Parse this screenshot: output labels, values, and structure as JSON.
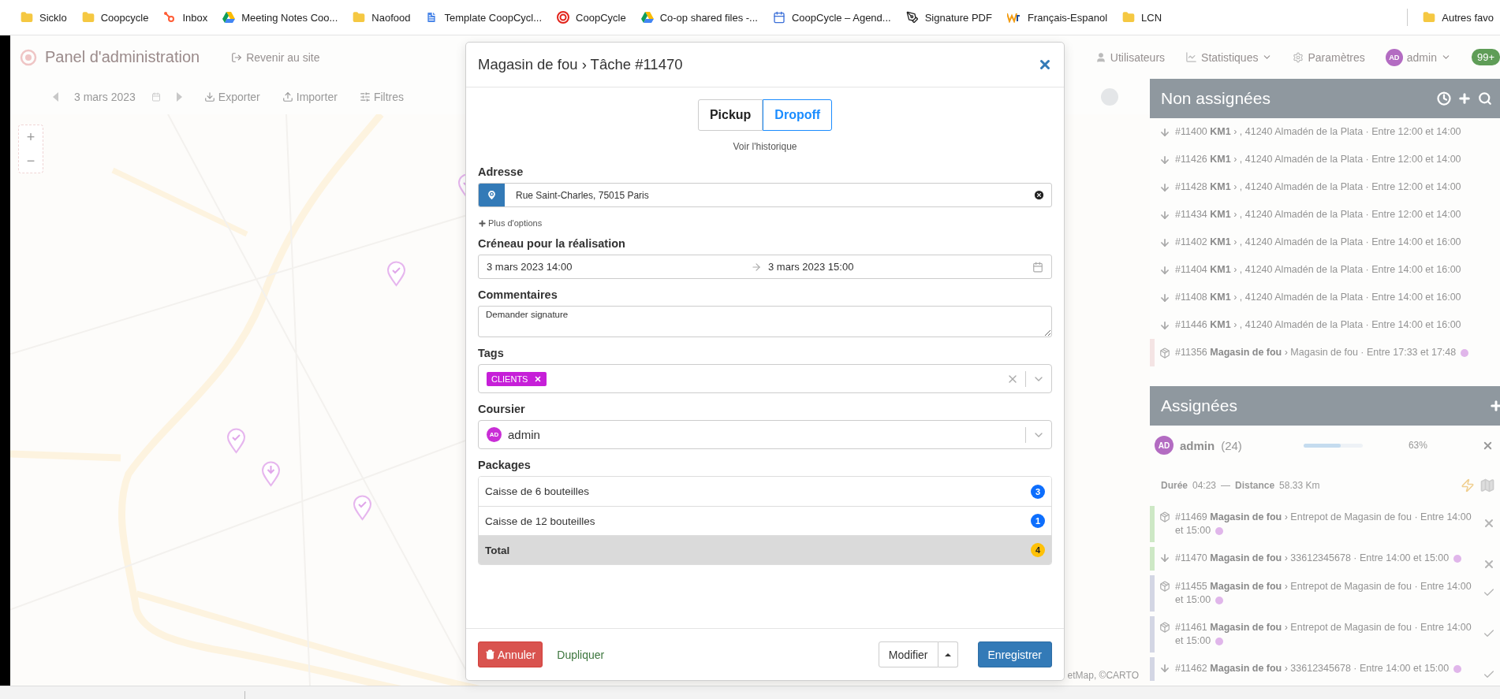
{
  "bookmarks": [
    {
      "label": "Sicklo"
    },
    {
      "label": "Coopcycle"
    },
    {
      "label": "Inbox"
    },
    {
      "label": "Meeting Notes Coo..."
    },
    {
      "label": "Naofood"
    },
    {
      "label": "Template CoopCycl..."
    },
    {
      "label": "CoopCycle"
    },
    {
      "label": "Co-op shared files -..."
    },
    {
      "label": "CoopCycle – Agend..."
    },
    {
      "label": "Signature PDF"
    },
    {
      "label": "Français-Espanol"
    },
    {
      "label": "LCN"
    }
  ],
  "other_bookmarks": "Autres favo",
  "admin_nav": {
    "title": "Panel d'administration",
    "back_link": "Revenir au site",
    "links": [
      {
        "label": "Utilisateurs",
        "dropdown": false
      },
      {
        "label": "Statistiques",
        "dropdown": true
      },
      {
        "label": "Paramètres",
        "dropdown": false
      }
    ],
    "user": {
      "initials": "AD",
      "name": "admin"
    },
    "notifications": "99+"
  },
  "toolbar": {
    "date": "3 mars 2023",
    "actions": [
      "Exporter",
      "Importer",
      "Filtres"
    ]
  },
  "map": {
    "zoom_in": "+",
    "zoom_out": "−",
    "attribution": "etMap, ©CARTO",
    "markers": [
      {
        "kind": "done"
      },
      {
        "kind": "done"
      },
      {
        "kind": "done"
      },
      {
        "kind": "dropoff"
      },
      {
        "kind": "done"
      }
    ]
  },
  "unassigned": {
    "title": "Non assignées",
    "tasks": [
      {
        "kind": "dropoff",
        "text": "#11400 **KM1** › , 41240 Almadén de la Plata · Entre 12:00 et 14:00"
      },
      {
        "kind": "dropoff",
        "text": "#11426 **KM1** › , 41240 Almadén de la Plata · Entre 12:00 et 14:00"
      },
      {
        "kind": "dropoff",
        "text": "#11428 **KM1** › , 41240 Almadén de la Plata · Entre 12:00 et 14:00"
      },
      {
        "kind": "dropoff",
        "text": "#11434 **KM1** › , 41240 Almadén de la Plata · Entre 12:00 et 14:00"
      },
      {
        "kind": "dropoff",
        "text": "#11402 **KM1** › , 41240 Almadén de la Plata · Entre 14:00 et 16:00"
      },
      {
        "kind": "dropoff",
        "text": "#11404 **KM1** › , 41240 Almadén de la Plata · Entre 14:00 et 16:00"
      },
      {
        "kind": "dropoff",
        "text": "#11408 **KM1** › , 41240 Almadén de la Plata · Entre 14:00 et 16:00"
      },
      {
        "kind": "dropoff",
        "text": "#11446 **KM1** › , 41240 Almadén de la Plata · Entre 14:00 et 16:00"
      },
      {
        "kind": "pickup",
        "text": "#11356 **Magasin de fou** › Magasin de fou · Entre 17:33 et 17:48",
        "dot": true,
        "color": "#f4e4e4"
      }
    ]
  },
  "assigned": {
    "title": "Assignées",
    "courier": {
      "initials": "AD",
      "name": "admin",
      "count": "(24)",
      "level": 0.63,
      "percent": "63%"
    },
    "duration_label": "Durée",
    "duration": "04:23",
    "separator": "—",
    "distance_label": "Distance",
    "distance": "58.33 Km",
    "tasks": [
      {
        "kind": "pickup",
        "text": "#11469 **Magasin de fou** › Entrepot de Magasin de fou · Entre 14:00 et 15:00",
        "dot": true,
        "color": "#cde8c5",
        "done": false
      },
      {
        "kind": "dropoff",
        "text": "#11470 **Magasin de fou** › 33612345678 · Entre 14:00 et 15:00",
        "dot": true,
        "color": "#cde8c5",
        "done": false
      },
      {
        "kind": "pickup",
        "text": "#11455 **Magasin de fou** › Entrepot de Magasin de fou · Entre 14:00 et 15:00",
        "dot": true,
        "color": "#d3d6e4",
        "done": true
      },
      {
        "kind": "pickup",
        "text": "#11461 **Magasin de fou** › Entrepot de Magasin de fou · Entre 14:00 et 15:00",
        "dot": true,
        "color": "#d3d6e4",
        "done": true
      },
      {
        "kind": "dropoff",
        "text": "#11462 **Magasin de fou** › 33612345678 · Entre 14:00 et 15:00",
        "dot": true,
        "color": "#d3d6e4",
        "done": true
      }
    ]
  },
  "modal": {
    "title": "Magasin de fou › Tâche #11470",
    "tabs": [
      {
        "label": "Pickup",
        "selected": false
      },
      {
        "label": "Dropoff",
        "selected": true
      }
    ],
    "history_link": "Voir l'historique",
    "address": {
      "label": "Adresse",
      "value": "Rue Saint-Charles, 75015 Paris"
    },
    "more_options": "Plus d'options",
    "slot": {
      "label": "Créneau pour la réalisation",
      "start": "3 mars 2023 14:00",
      "end": "3 mars 2023 15:00"
    },
    "comments": {
      "label": "Commentaires",
      "value": "Demander signature"
    },
    "tags": {
      "label": "Tags",
      "items": [
        {
          "label": "CLIENTS",
          "color": "#c61fd8"
        }
      ]
    },
    "courier": {
      "label": "Coursier",
      "initials": "AD",
      "name": "admin"
    },
    "packages": {
      "label": "Packages",
      "items": [
        {
          "kind": "item",
          "name": "Caisse de 6 bouteilles",
          "count": "3"
        },
        {
          "kind": "item",
          "name": "Caisse de 12 bouteilles",
          "count": "1"
        },
        {
          "kind": "total",
          "name": "Total",
          "count": "4"
        }
      ]
    },
    "footer": {
      "cancel": "Annuler",
      "duplicate": "Dupliquer",
      "modify": "Modifier",
      "save": "Enregistrer"
    }
  }
}
